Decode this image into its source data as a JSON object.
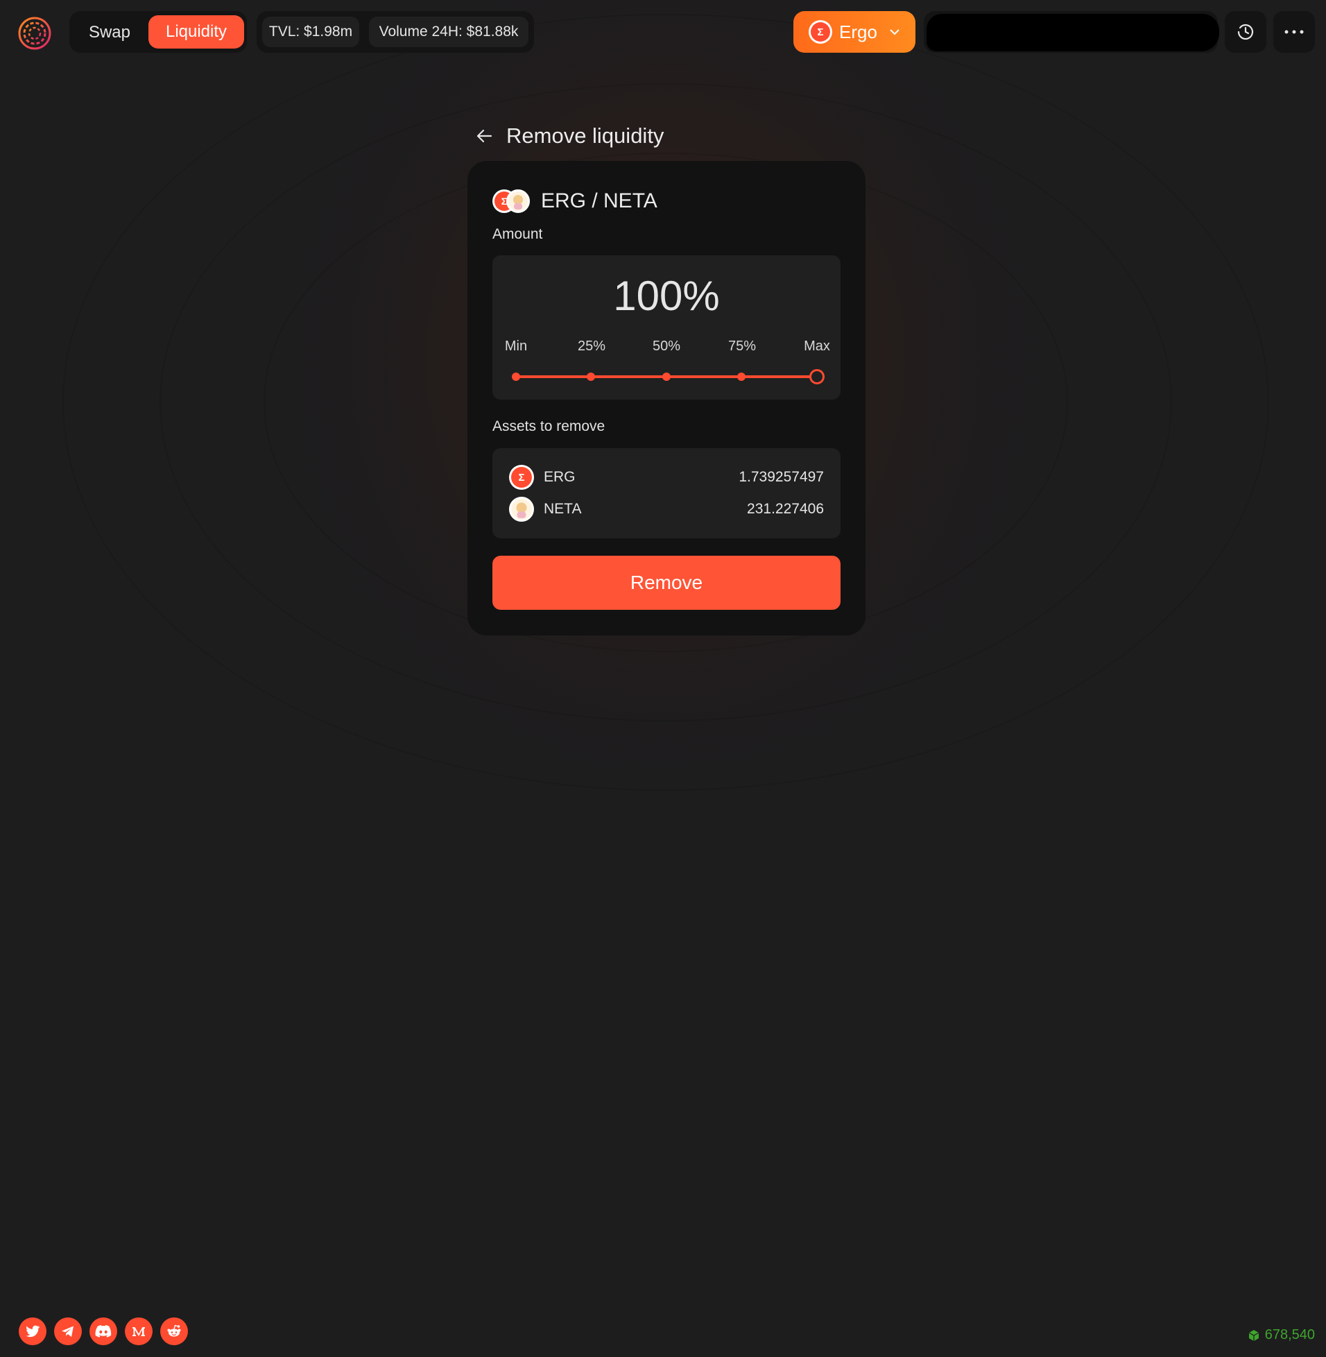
{
  "header": {
    "nav": {
      "swap_label": "Swap",
      "liquidity_label": "Liquidity"
    },
    "stats": {
      "tvl": "TVL: $1.98m",
      "volume": "Volume 24H: $81.88k"
    },
    "network": {
      "label": "Ergo",
      "icon": "ergo-icon"
    }
  },
  "page": {
    "title": "Remove liquidity",
    "pair": "ERG / NETA",
    "amount_label": "Amount",
    "amount_value": "100%",
    "amount_fraction": 1.0,
    "ticks": [
      "Min",
      "25%",
      "50%",
      "75%",
      "Max"
    ],
    "assets_label": "Assets to remove",
    "assets": [
      {
        "symbol": "ERG",
        "amount": "1.739257497"
      },
      {
        "symbol": "NETA",
        "amount": "231.227406"
      }
    ],
    "remove_label": "Remove"
  },
  "footer": {
    "socials": [
      "twitter-icon",
      "telegram-icon",
      "discord-icon",
      "medium-icon",
      "reddit-icon"
    ],
    "block_height": "678,540"
  },
  "colors": {
    "accent": "#ff5436",
    "network": "#ff7a1c",
    "block": "#3fa52c",
    "background": "#1d1d1e"
  }
}
